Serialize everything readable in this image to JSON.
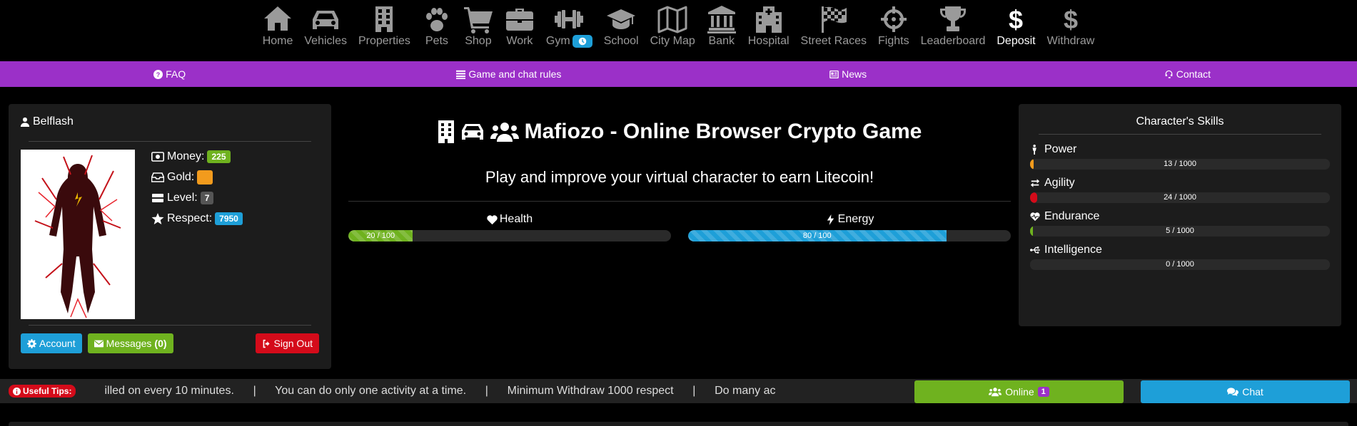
{
  "nav": [
    {
      "label": "Home",
      "icon": "home-icon"
    },
    {
      "label": "Vehicles",
      "icon": "car-icon"
    },
    {
      "label": "Properties",
      "icon": "building-icon"
    },
    {
      "label": "Pets",
      "icon": "paw-icon"
    },
    {
      "label": "Shop",
      "icon": "cart-icon"
    },
    {
      "label": "Work",
      "icon": "briefcase-icon"
    },
    {
      "label": "Gym",
      "icon": "dumbbell-icon"
    },
    {
      "label": "School",
      "icon": "graduation-cap-icon"
    },
    {
      "label": "City Map",
      "icon": "map-icon"
    },
    {
      "label": "Bank",
      "icon": "bank-icon"
    },
    {
      "label": "Hospital",
      "icon": "hospital-icon"
    },
    {
      "label": "Street Races",
      "icon": "checkered-flag-icon"
    },
    {
      "label": "Fights",
      "icon": "crosshairs-icon"
    },
    {
      "label": "Leaderboard",
      "icon": "trophy-icon"
    },
    {
      "label": "Deposit",
      "icon": "dollar-icon"
    },
    {
      "label": "Withdraw",
      "icon": "dollar-icon"
    }
  ],
  "subnav": {
    "faq": "FAQ",
    "rules": "Game and chat rules",
    "news": "News",
    "contact": "Contact"
  },
  "profile": {
    "username": "Belflash",
    "money_label": "Money:",
    "money": "225",
    "gold_label": "Gold:",
    "level_label": "Level:",
    "level": "7",
    "respect_label": "Respect:",
    "respect": "7950",
    "account_btn": "Account",
    "messages_btn": "Messages",
    "messages_count": "(0)",
    "signout_btn": "Sign Out"
  },
  "main": {
    "title": "Mafiozo - Online Browser Crypto Game",
    "subtitle": "Play and improve your virtual character to earn Litecoin!",
    "health_label": "Health",
    "health_text": "20 / 100",
    "health_value": 20,
    "health_max": 100,
    "energy_label": "Energy",
    "energy_text": "80 / 100",
    "energy_value": 80,
    "energy_max": 100
  },
  "skills": {
    "title": "Character's Skills",
    "items": [
      {
        "name": "Power",
        "text": "13 / 1000",
        "value": 13,
        "max": 1000,
        "color": "#f29b1d"
      },
      {
        "name": "Agility",
        "text": "24 / 1000",
        "value": 24,
        "max": 1000,
        "color": "#d40b1a"
      },
      {
        "name": "Endurance",
        "text": "5 / 1000",
        "value": 5,
        "max": 1000,
        "color": "#6fb21f"
      },
      {
        "name": "Intelligence",
        "text": "0 / 1000",
        "value": 0,
        "max": 1000,
        "color": "#2a2a2a"
      }
    ]
  },
  "bottom": {
    "tips_label": "Useful Tips:",
    "ticker": "illed on every 10 minutes.      |      You can do only one activity at a time.      |      Minimum Withdraw 1000 respect      |      Do many ac",
    "online_label": "Online",
    "online_count": "1",
    "chat_label": "Chat"
  },
  "colors": {
    "purple": "#9b30c8",
    "green": "#6fb21f",
    "blue": "#1e9fd8",
    "red": "#d40b1a",
    "orange": "#f29b1d"
  }
}
